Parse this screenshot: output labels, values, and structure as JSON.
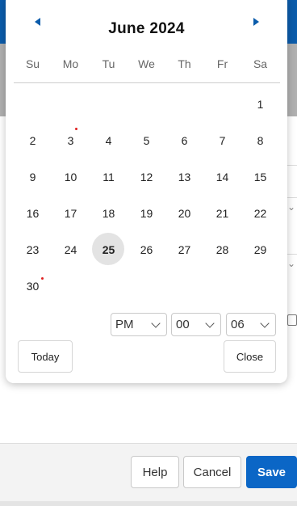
{
  "datepicker": {
    "month_title": "June 2024",
    "weekdays": [
      "Su",
      "Mo",
      "Tu",
      "We",
      "Th",
      "Fr",
      "Sa"
    ],
    "selected_day": "25",
    "days": [
      "1",
      "2",
      "3",
      "4",
      "5",
      "6",
      "7",
      "8",
      "9",
      "10",
      "11",
      "12",
      "13",
      "14",
      "15",
      "16",
      "17",
      "18",
      "19",
      "20",
      "21",
      "22",
      "23",
      "24",
      "25",
      "26",
      "27",
      "28",
      "29",
      "30"
    ],
    "time": {
      "ampm": "PM",
      "hour": "00",
      "minute": "06"
    },
    "today_label": "Today",
    "close_label": "Close",
    "nav": {
      "prev_icon": "triangle-left-icon",
      "next_icon": "triangle-right-icon",
      "accent": "#0b5cab"
    },
    "event_dot_color": "#e02020"
  },
  "footer": {
    "help_label": "Help",
    "cancel_label": "Cancel",
    "save_label": "Save",
    "save_color": "#0b66c6"
  }
}
